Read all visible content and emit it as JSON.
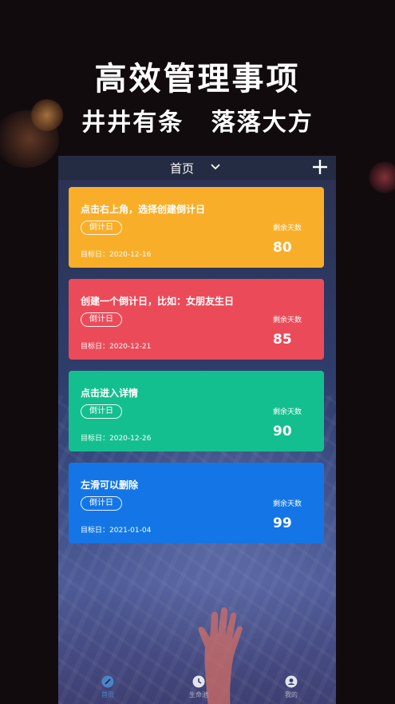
{
  "promo": {
    "headline": "高效管理事项",
    "subline": "井井有条 落落大方"
  },
  "header": {
    "title": "首页",
    "dropdown_icon": "chevron-down-icon",
    "add_icon": "plus-icon"
  },
  "cards": [
    {
      "title": "点击右上角，选择创建倒计日",
      "tag": "倒计日",
      "date": "目标日：2020-12-16",
      "remain_label": "剩余天数",
      "days": "80",
      "color": "#f9ae2a"
    },
    {
      "title": "创建一个倒计日，比如：女朋友生日",
      "tag": "倒计日",
      "date": "目标日：2020-12-21",
      "remain_label": "剩余天数",
      "days": "85",
      "color": "#eb4b59"
    },
    {
      "title": "点击进入详情",
      "tag": "倒计日",
      "date": "目标日：2020-12-26",
      "remain_label": "剩余天数",
      "days": "90",
      "color": "#14bf8f"
    },
    {
      "title": "左滑可以删除",
      "tag": "倒计日",
      "date": "目标日：2021-01-04",
      "remain_label": "剩余天数",
      "days": "99",
      "color": "#1476e6"
    }
  ],
  "tabs": [
    {
      "label": "首页",
      "icon": "compass-icon",
      "active": true
    },
    {
      "label": "生命池",
      "icon": "clock-icon",
      "active": false
    },
    {
      "label": "我的",
      "icon": "user-icon",
      "active": false
    }
  ]
}
